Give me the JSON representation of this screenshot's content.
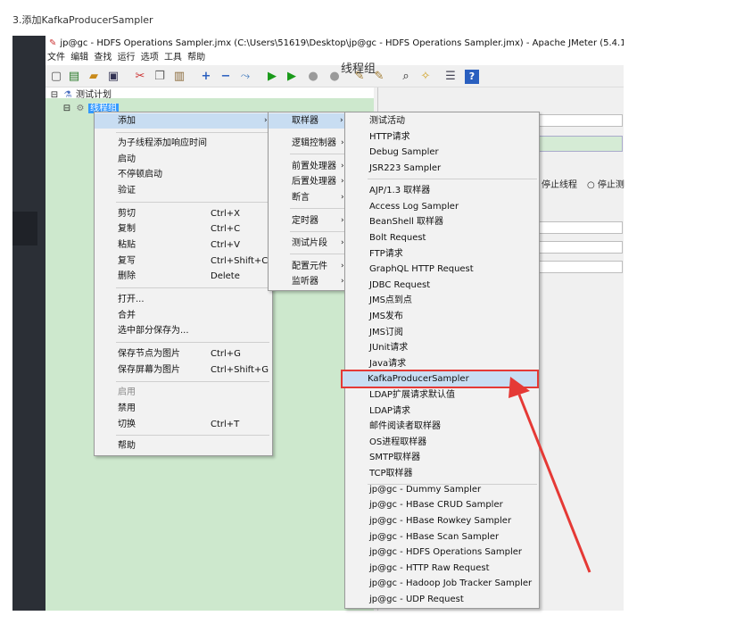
{
  "caption": "3.添加KafkaProducerSampler",
  "window": {
    "title": "jp@gc - HDFS Operations Sampler.jmx (C:\\Users\\51619\\Desktop\\jp@gc - HDFS Operations Sampler.jmx) - Apache JMeter (5.4.1-SNAPS",
    "title_icon": "✎"
  },
  "menubar": [
    "文件",
    "编辑",
    "查找",
    "运行",
    "选项",
    "工具",
    "帮助"
  ],
  "toolbar_icons": [
    "new-icon",
    "templates-icon",
    "open-icon",
    "save-icon",
    "cut-icon",
    "copy-icon",
    "paste-icon",
    "expand-icon",
    "collapse-icon",
    "toggle-icon",
    "start-icon",
    "start-no-pause-icon",
    "stop-icon",
    "shutdown-icon",
    "clear-icon",
    "clear-all-icon",
    "search-icon",
    "reset-search-icon",
    "function-helper-icon",
    "help-icon"
  ],
  "tree": {
    "root": "测试计划",
    "thread_group": "线程组"
  },
  "panel": {
    "title": "线程组",
    "stop_thread": "停止线程",
    "stop_test": "停止测"
  },
  "context_menu": {
    "items": [
      {
        "label": "添加",
        "submenu": true
      },
      {
        "label": "为子线程添加响应时间"
      },
      {
        "label": "启动"
      },
      {
        "label": "不停顿启动"
      },
      {
        "label": "验证"
      },
      {
        "label": "剪切",
        "shortcut": "Ctrl+X"
      },
      {
        "label": "复制",
        "shortcut": "Ctrl+C"
      },
      {
        "label": "粘贴",
        "shortcut": "Ctrl+V"
      },
      {
        "label": "复写",
        "shortcut": "Ctrl+Shift+C"
      },
      {
        "label": "删除",
        "shortcut": "Delete"
      },
      {
        "label": "打开..."
      },
      {
        "label": "合并"
      },
      {
        "label": "选中部分保存为..."
      },
      {
        "label": "保存节点为图片",
        "shortcut": "Ctrl+G"
      },
      {
        "label": "保存屏幕为图片",
        "shortcut": "Ctrl+Shift+G"
      },
      {
        "label": "启用"
      },
      {
        "label": "禁用"
      },
      {
        "label": "切换",
        "shortcut": "Ctrl+T"
      },
      {
        "label": "帮助"
      }
    ]
  },
  "add_menu": {
    "items": [
      "取样器",
      "逻辑控制器",
      "前置处理器",
      "后置处理器",
      "断言",
      "定时器",
      "测试片段",
      "配置元件",
      "监听器"
    ]
  },
  "sampler_menu": {
    "items": [
      "测试活动",
      "HTTP请求",
      "Debug Sampler",
      "JSR223 Sampler",
      "AJP/1.3 取样器",
      "Access Log Sampler",
      "BeanShell 取样器",
      "Bolt Request",
      "FTP请求",
      "GraphQL HTTP Request",
      "JDBC Request",
      "JMS点到点",
      "JMS发布",
      "JMS订阅",
      "JUnit请求",
      "Java请求",
      "KafkaProducerSampler",
      "LDAP扩展请求默认值",
      "LDAP请求",
      "邮件阅读者取样器",
      "OS进程取样器",
      "SMTP取样器",
      "TCP取样器",
      "jp@gc - Dummy Sampler",
      "jp@gc - HBase CRUD Sampler",
      "jp@gc - HBase Rowkey Sampler",
      "jp@gc - HBase Scan Sampler",
      "jp@gc - HDFS Operations Sampler",
      "jp@gc - HTTP Raw Request",
      "jp@gc - Hadoop Job Tracker Sampler",
      "jp@gc - UDP Request"
    ]
  },
  "colors": {
    "tree_bg": "#cde8cd",
    "selection": "#c8ddf2",
    "annotation": "#e53935"
  }
}
